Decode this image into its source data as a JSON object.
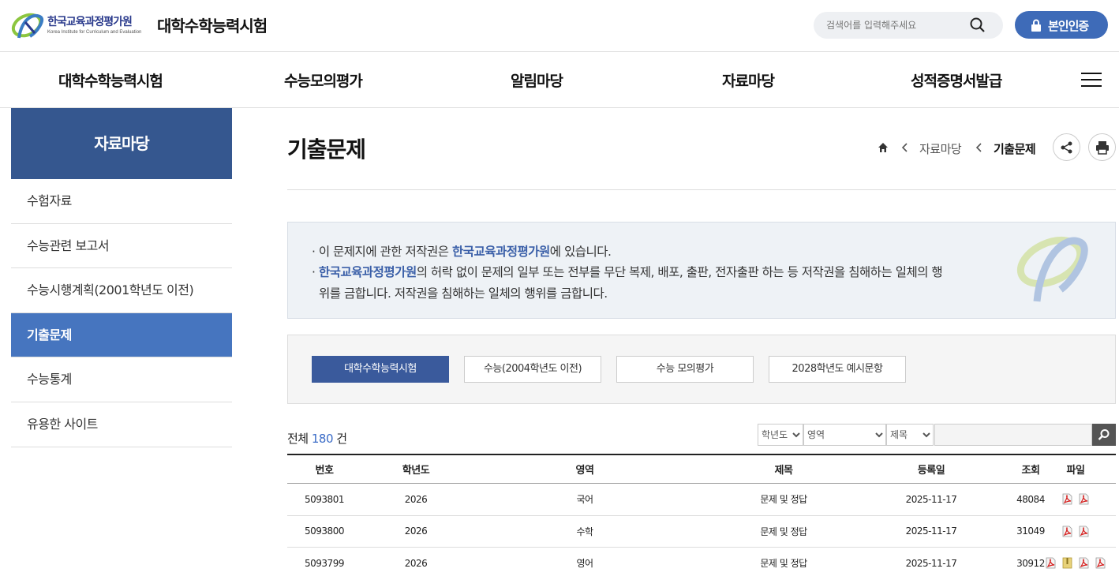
{
  "header": {
    "logo_kr": "한국교육과정평가원",
    "logo_en": "Korea Institute for Curriculum and Evaluation",
    "site_title": "대학수학능력시험",
    "search_placeholder": "검색어를 입력해주세요",
    "auth_label": "본인인증",
    "accent": "#3e6bb8"
  },
  "gnb": {
    "items": [
      "대학수학능력시험",
      "수능모의평가",
      "알림마당",
      "자료마당",
      "성적증명서발급"
    ]
  },
  "sidebar": {
    "title": "자료마당",
    "items": [
      {
        "label": "수험자료",
        "active": false
      },
      {
        "label": "수능관련 보고서",
        "active": false
      },
      {
        "label": "수능시행계획(2001학년도 이전)",
        "active": false
      },
      {
        "label": "기출문제",
        "active": true
      },
      {
        "label": "수능통계",
        "active": false
      },
      {
        "label": "유용한 사이트",
        "active": false
      }
    ]
  },
  "page": {
    "title": "기출문제",
    "breadcrumb": [
      "자료마당",
      "기출문제"
    ]
  },
  "notice": {
    "line1_pre": "· 이 문제지에 관한 저작권은 ",
    "line1_hl": "한국교육과정평가원",
    "line1_post": "에 있습니다.",
    "line2_pre": "· ",
    "line2_hl": "한국교육과정평가원",
    "line2_post": "의 허락 없이 문제의 일부 또는 전부를 무단 복제, 배포, 출판, 전자출판 하는 등 저작권을 침해하는 일체의 행",
    "line3": "위를 금합니다. 저작권을 침해하는 일체의 행위를 금합니다."
  },
  "tabs": [
    {
      "label": "대학수학능력시험",
      "active": true
    },
    {
      "label": "수능(2004학년도 이전)",
      "active": false
    },
    {
      "label": "수능 모의평가",
      "active": false
    },
    {
      "label": "2028학년도 예시문항",
      "active": false
    }
  ],
  "list": {
    "total_pre": "전체 ",
    "total_count": "180",
    "total_post": " 건",
    "filter_year": "학년도",
    "filter_area": "영역",
    "filter_field": "제목",
    "columns": [
      "번호",
      "학년도",
      "영역",
      "제목",
      "등록일",
      "조회",
      "파일"
    ],
    "rows": [
      {
        "no": "5093801",
        "year": "2026",
        "area": "국어",
        "title": "문제 및 정답",
        "date": "2025-11-17",
        "views": "48084",
        "files": [
          "pdf",
          "pdf"
        ]
      },
      {
        "no": "5093800",
        "year": "2026",
        "area": "수학",
        "title": "문제 및 정답",
        "date": "2025-11-17",
        "views": "31049",
        "files": [
          "pdf",
          "pdf"
        ]
      },
      {
        "no": "5093799",
        "year": "2026",
        "area": "영어",
        "title": "문제 및 정답",
        "date": "2025-11-17",
        "views": "30912",
        "files": [
          "pdf",
          "zip",
          "pdf",
          "pdf"
        ]
      }
    ]
  }
}
